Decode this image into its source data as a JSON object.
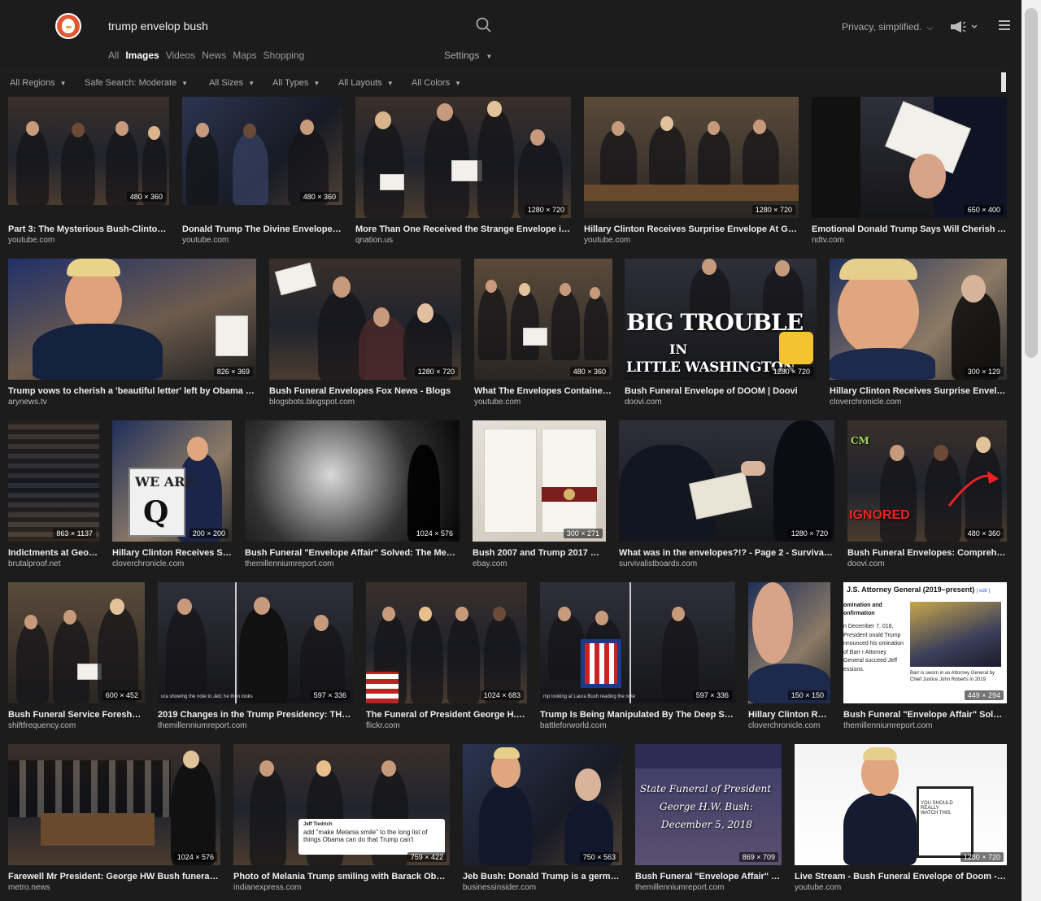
{
  "search": {
    "query": "trump envelop bush"
  },
  "header": {
    "privacy_label": "Privacy, simplified."
  },
  "nav": {
    "tabs": [
      {
        "label": "All"
      },
      {
        "label": "Images"
      },
      {
        "label": "Videos"
      },
      {
        "label": "News"
      },
      {
        "label": "Maps"
      },
      {
        "label": "Shopping"
      }
    ],
    "settings_label": "Settings"
  },
  "filters": [
    {
      "label": "All Regions"
    },
    {
      "label": "Safe Search: Moderate"
    },
    {
      "label": "All Sizes"
    },
    {
      "label": "All Types"
    },
    {
      "label": "All Layouts"
    },
    {
      "label": "All Colors"
    }
  ],
  "results": [
    {
      "dims": "480 × 360",
      "title": "Part 3: The Mysterious Bush-Clinton-O...",
      "source": "youtube.com"
    },
    {
      "dims": "480 × 360",
      "title": "Donald Trump The Divine Envelope: F...",
      "source": "youtube.com"
    },
    {
      "dims": "1280 × 720",
      "title": "More Than One Received the Strange Envelope in t...",
      "source": "qnation.us"
    },
    {
      "dims": "1280 × 720",
      "title": "Hillary Clinton Receives Surprise Envelope At Georg...",
      "source": "youtube.com"
    },
    {
      "dims": "650 × 400",
      "title": "Emotional Donald Trump Says Will Cherish A 'B...",
      "source": "ndtv.com"
    },
    {
      "dims": "826 × 369",
      "title": "Trump vows to cherish a 'beautiful letter' left by Obama - AR...",
      "source": "arynews.tv"
    },
    {
      "dims": "1280 × 720",
      "title": "Bush Funeral Envelopes Fox News - Blogs",
      "source": "blogsbots.blogspot.com"
    },
    {
      "dims": "480 × 360",
      "title": "What The Envelopes Contained (...",
      "source": "youtube.com"
    },
    {
      "dims": "1280 × 720",
      "title": "Bush Funeral Envelope of DOOM | Doovi",
      "source": "doovi.com",
      "overlay": [
        "BIG TROUBLE",
        "IN",
        "LITTLE WASHINGTON"
      ]
    },
    {
      "dims": "300 × 129",
      "title": "Hillary Clinton Receives Surprise Envelope ...",
      "source": "cloverchronicle.com"
    },
    {
      "dims": "863 × 1137",
      "title": "Indictments at Georg...",
      "source": "brutalproof.net"
    },
    {
      "dims": "200 × 200",
      "title": "Hillary Clinton Receives Sur...",
      "source": "cloverchronicle.com",
      "overlay": [
        "WE ARE",
        "Q"
      ]
    },
    {
      "dims": "1024 × 576",
      "title": "Bush Funeral \"Envelope Affair\" Solved: The Mexican...",
      "source": "themillenniumreport.com"
    },
    {
      "dims": "300 × 271",
      "title": "Bush 2007 and Trump 2017 Wh...",
      "source": "ebay.com"
    },
    {
      "dims": "1280 × 720",
      "title": "What was in the envelopes?!? - Page 2 - Survivalist F...",
      "source": "survivalistboards.com"
    },
    {
      "dims": "480 × 360",
      "title": "Bush Funeral Envelopes: Comprehens...",
      "source": "doovi.com",
      "overlay": [
        "CM",
        "IGNORED"
      ]
    },
    {
      "dims": "600 × 452",
      "title": "Bush Funeral Service Foreshado...",
      "source": "shiftfrequency.com"
    },
    {
      "dims": "597 × 336",
      "title": "2019 Changes in the Trump Presidency: THE HI...",
      "source": "themillenniumreport.com",
      "caption": "ura showing the note to Jeb; he then looks"
    },
    {
      "dims": "1024 × 683",
      "title": "The Funeral of President George H.W. ...",
      "source": "flickr.com"
    },
    {
      "dims": "597 × 336",
      "title": "Trump Is Being Manipulated By The Deep State...",
      "source": "battleforworld.com",
      "caption": "mp looking at Laura Bush reading the note"
    },
    {
      "dims": "150 × 150",
      "title": "Hillary Clinton Rec...",
      "source": "cloverchronicle.com"
    },
    {
      "dims": "449 × 294",
      "title": "Bush Funeral \"Envelope Affair\" Solved: ...",
      "source": "themillenniumreport.com",
      "wiki": {
        "heading": "J.S. Attorney General (2019–present)",
        "edit": "[ edit ]",
        "sub": "omination and onfirmation",
        "body": "n December 7, 018, President onald Trump nnounced his omination of Barr r Attorney General succeed Jeff essions.",
        "caption": "Barr is sworn in as Attorney General by Chief Justice John Roberts in 2019"
      }
    },
    {
      "dims": "1024 × 576",
      "title": "Farewell Mr President: George HW Bush funeral in ...",
      "source": "metro.news"
    },
    {
      "dims": "759 × 422",
      "title": "Photo of Melania Trump smiling with Barack Obama ...",
      "source": "indianexpress.com",
      "tweet": {
        "handle": "Jeff Tiedrich",
        "text": "add \"make Melania smile\" to the long list of things Obama can do that Trump can't"
      }
    },
    {
      "dims": "750 × 563",
      "title": "Jeb Bush: Donald Trump is a germoph...",
      "source": "businessinsider.com"
    },
    {
      "dims": "869 × 709",
      "title": "Bush Funeral \"Envelope Affair\" Sol...",
      "source": "themillenniumreport.com",
      "overlay": [
        "State Funeral of President",
        "George H.W. Bush:",
        "December 5, 2018"
      ]
    },
    {
      "dims": "1280 × 720",
      "title": "Live Stream - Bush Funeral Envelope of Doom - You...",
      "source": "youtube.com",
      "overlay": [
        "YOU SHOULD REALLY WATCH THIS."
      ]
    }
  ],
  "colors": {
    "background": "#1c1c1c",
    "brand": "#de5833",
    "text": "#eeeeee",
    "muted": "#aaaaaa"
  }
}
